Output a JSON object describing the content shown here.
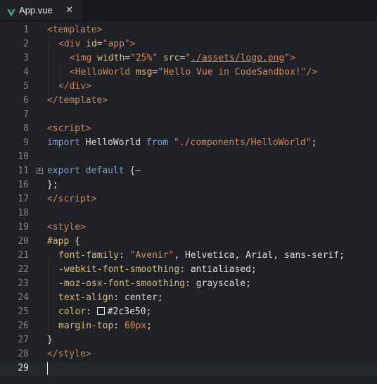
{
  "tab": {
    "title": "App.vue",
    "icon": "vue-logo-icon",
    "close_glyph": "✕"
  },
  "colors": {
    "vue_green": "#41b883",
    "vue_dark": "#35495e",
    "swatch": "#2c3e50"
  },
  "gutter": {
    "line_numbers": [
      "1",
      "2",
      "3",
      "4",
      "5",
      "6",
      "7",
      "8",
      "9",
      "10",
      "11",
      "16",
      "17",
      "18",
      "19",
      "20",
      "21",
      "22",
      "23",
      "24",
      "25",
      "26",
      "27",
      "28",
      "29"
    ],
    "active_line": "29"
  },
  "code": {
    "l1": {
      "lt": "<",
      "tag": "template",
      "gt": ">"
    },
    "l2": {
      "lt": "<",
      "tag": "div",
      "attr": "id",
      "eq": "=",
      "val": "\"app\"",
      "gt": ">"
    },
    "l3": {
      "lt": "<",
      "tag": "img",
      "attr1": "width",
      "eq1": "=",
      "val1": "\"25%\"",
      "attr2": "src",
      "eq2": "=",
      "q1": "\"",
      "path": "./assets/logo.png",
      "q2": "\"",
      "gt": ">"
    },
    "l4": {
      "lt": "<",
      "tag": "HelloWorld",
      "attr": "msg",
      "eq": "=",
      "val": "\"Hello Vue in CodeSandbox!\"",
      "gt": "/>"
    },
    "l5": {
      "lt": "</",
      "tag": "div",
      "gt": ">"
    },
    "l6": {
      "lt": "</",
      "tag": "template",
      "gt": ">"
    },
    "l8": {
      "lt": "<",
      "tag": "script",
      "gt": ">"
    },
    "l9": {
      "kw1": "import",
      "id": "HelloWorld",
      "kw2": "from",
      "str": "\"./components/HelloWorld\"",
      "punc": ";"
    },
    "l11": {
      "kw1": "export",
      "kw2": "default",
      "brace": "{",
      "fold": "⋯"
    },
    "l16": {
      "text": "};"
    },
    "l17": {
      "lt": "</",
      "tag": "script",
      "gt": ">"
    },
    "l19": {
      "lt": "<",
      "tag": "style",
      "gt": ">"
    },
    "l20": {
      "sel": "#app",
      "brace": "{"
    },
    "l21": {
      "prop": "font-family",
      "colon": ":",
      "str": "\"Avenir\"",
      "rest": ", Helvetica, Arial, sans-serif;"
    },
    "l22": {
      "prop": "-webkit-font-smoothing",
      "colon": ":",
      "val": "antialiased;"
    },
    "l23": {
      "prop": "-moz-osx-font-smoothing",
      "colon": ":",
      "val": "grayscale;"
    },
    "l24": {
      "prop": "text-align",
      "colon": ":",
      "val": "center;"
    },
    "l25": {
      "prop": "color",
      "colon": ":",
      "val": "#2c3e50;"
    },
    "l26": {
      "prop": "margin-top",
      "colon": ":",
      "num": "60px",
      "end": ";"
    },
    "l27": {
      "text": "}"
    },
    "l28": {
      "lt": "</",
      "tag": "style",
      "gt": ">"
    }
  }
}
